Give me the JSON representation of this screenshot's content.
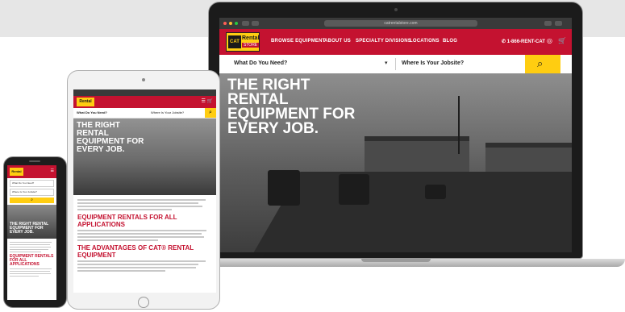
{
  "laptop": {
    "url_text": "catrentalstore.com",
    "logo": {
      "cat": "CAT",
      "rental": "Rental",
      "store": "STORE"
    },
    "nav_items": [
      "BROWSE EQUIPMENT",
      "ABOUT US",
      "SPECIALTY DIVISIONS",
      "LOCATIONS",
      "BLOG"
    ],
    "phone": "1-866-RENT-CAT",
    "icons": [
      "phone-icon",
      "user-icon",
      "cart-icon",
      "search-icon",
      "chevron-down-icon"
    ],
    "search": {
      "what_label": "What Do You Need?",
      "where_label": "Where Is Your Jobsite?",
      "caret": "▾",
      "button_icon": "⚲"
    },
    "hero_title": "THE RIGHT RENTAL EQUIPMENT FOR EVERY JOB."
  },
  "tablet": {
    "search": {
      "what_label": "What Do You Need?",
      "where_label": "Where Is Your Jobsite?"
    },
    "hero_title": "THE RIGHT RENTAL EQUIPMENT FOR EVERY JOB.",
    "heading_1": "EQUIPMENT RENTALS FOR ALL APPLICATIONS",
    "heading_2": "THE ADVANTAGES OF CAT® RENTAL EQUIPMENT"
  },
  "phone": {
    "search": {
      "what_label": "What Do You Need?",
      "where_label": "Where Is Your Jobsite?"
    },
    "hero_title": "THE RIGHT RENTAL EQUIPMENT FOR EVERY JOB.",
    "heading_1": "EQUIPMENT RENTALS FOR ALL APPLICATIONS"
  },
  "colors": {
    "brand_red": "#c41230",
    "cat_yellow": "#ffcd11"
  }
}
